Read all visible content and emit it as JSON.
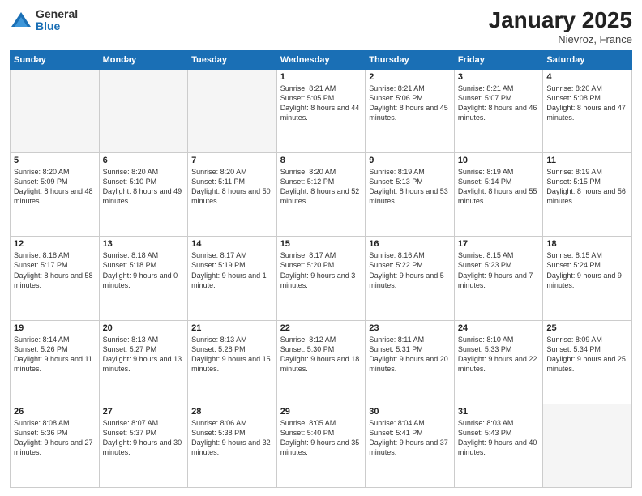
{
  "logo": {
    "general": "General",
    "blue": "Blue"
  },
  "header": {
    "month": "January 2025",
    "location": "Nievroz, France"
  },
  "weekdays": [
    "Sunday",
    "Monday",
    "Tuesday",
    "Wednesday",
    "Thursday",
    "Friday",
    "Saturday"
  ],
  "weeks": [
    [
      {
        "day": "",
        "empty": true
      },
      {
        "day": "",
        "empty": true
      },
      {
        "day": "",
        "empty": true
      },
      {
        "day": "1",
        "sunrise": "8:21 AM",
        "sunset": "5:05 PM",
        "daylight": "8 hours and 44 minutes."
      },
      {
        "day": "2",
        "sunrise": "8:21 AM",
        "sunset": "5:06 PM",
        "daylight": "8 hours and 45 minutes."
      },
      {
        "day": "3",
        "sunrise": "8:21 AM",
        "sunset": "5:07 PM",
        "daylight": "8 hours and 46 minutes."
      },
      {
        "day": "4",
        "sunrise": "8:20 AM",
        "sunset": "5:08 PM",
        "daylight": "8 hours and 47 minutes."
      }
    ],
    [
      {
        "day": "5",
        "sunrise": "8:20 AM",
        "sunset": "5:09 PM",
        "daylight": "8 hours and 48 minutes."
      },
      {
        "day": "6",
        "sunrise": "8:20 AM",
        "sunset": "5:10 PM",
        "daylight": "8 hours and 49 minutes."
      },
      {
        "day": "7",
        "sunrise": "8:20 AM",
        "sunset": "5:11 PM",
        "daylight": "8 hours and 50 minutes."
      },
      {
        "day": "8",
        "sunrise": "8:20 AM",
        "sunset": "5:12 PM",
        "daylight": "8 hours and 52 minutes."
      },
      {
        "day": "9",
        "sunrise": "8:19 AM",
        "sunset": "5:13 PM",
        "daylight": "8 hours and 53 minutes."
      },
      {
        "day": "10",
        "sunrise": "8:19 AM",
        "sunset": "5:14 PM",
        "daylight": "8 hours and 55 minutes."
      },
      {
        "day": "11",
        "sunrise": "8:19 AM",
        "sunset": "5:15 PM",
        "daylight": "8 hours and 56 minutes."
      }
    ],
    [
      {
        "day": "12",
        "sunrise": "8:18 AM",
        "sunset": "5:17 PM",
        "daylight": "8 hours and 58 minutes."
      },
      {
        "day": "13",
        "sunrise": "8:18 AM",
        "sunset": "5:18 PM",
        "daylight": "9 hours and 0 minutes."
      },
      {
        "day": "14",
        "sunrise": "8:17 AM",
        "sunset": "5:19 PM",
        "daylight": "9 hours and 1 minute."
      },
      {
        "day": "15",
        "sunrise": "8:17 AM",
        "sunset": "5:20 PM",
        "daylight": "9 hours and 3 minutes."
      },
      {
        "day": "16",
        "sunrise": "8:16 AM",
        "sunset": "5:22 PM",
        "daylight": "9 hours and 5 minutes."
      },
      {
        "day": "17",
        "sunrise": "8:15 AM",
        "sunset": "5:23 PM",
        "daylight": "9 hours and 7 minutes."
      },
      {
        "day": "18",
        "sunrise": "8:15 AM",
        "sunset": "5:24 PM",
        "daylight": "9 hours and 9 minutes."
      }
    ],
    [
      {
        "day": "19",
        "sunrise": "8:14 AM",
        "sunset": "5:26 PM",
        "daylight": "9 hours and 11 minutes."
      },
      {
        "day": "20",
        "sunrise": "8:13 AM",
        "sunset": "5:27 PM",
        "daylight": "9 hours and 13 minutes."
      },
      {
        "day": "21",
        "sunrise": "8:13 AM",
        "sunset": "5:28 PM",
        "daylight": "9 hours and 15 minutes."
      },
      {
        "day": "22",
        "sunrise": "8:12 AM",
        "sunset": "5:30 PM",
        "daylight": "9 hours and 18 minutes."
      },
      {
        "day": "23",
        "sunrise": "8:11 AM",
        "sunset": "5:31 PM",
        "daylight": "9 hours and 20 minutes."
      },
      {
        "day": "24",
        "sunrise": "8:10 AM",
        "sunset": "5:33 PM",
        "daylight": "9 hours and 22 minutes."
      },
      {
        "day": "25",
        "sunrise": "8:09 AM",
        "sunset": "5:34 PM",
        "daylight": "9 hours and 25 minutes."
      }
    ],
    [
      {
        "day": "26",
        "sunrise": "8:08 AM",
        "sunset": "5:36 PM",
        "daylight": "9 hours and 27 minutes."
      },
      {
        "day": "27",
        "sunrise": "8:07 AM",
        "sunset": "5:37 PM",
        "daylight": "9 hours and 30 minutes."
      },
      {
        "day": "28",
        "sunrise": "8:06 AM",
        "sunset": "5:38 PM",
        "daylight": "9 hours and 32 minutes."
      },
      {
        "day": "29",
        "sunrise": "8:05 AM",
        "sunset": "5:40 PM",
        "daylight": "9 hours and 35 minutes."
      },
      {
        "day": "30",
        "sunrise": "8:04 AM",
        "sunset": "5:41 PM",
        "daylight": "9 hours and 37 minutes."
      },
      {
        "day": "31",
        "sunrise": "8:03 AM",
        "sunset": "5:43 PM",
        "daylight": "9 hours and 40 minutes."
      },
      {
        "day": "",
        "empty": true
      }
    ]
  ],
  "labels": {
    "sunrise_prefix": "Sunrise: ",
    "sunset_prefix": "Sunset: ",
    "daylight_prefix": "Daylight: "
  }
}
